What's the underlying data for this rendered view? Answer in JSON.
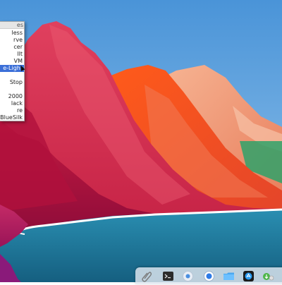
{
  "menu": {
    "header": "es",
    "items": [
      {
        "label": "less",
        "selected": false
      },
      {
        "label": "rve",
        "selected": false
      },
      {
        "label": "cer",
        "selected": false
      },
      {
        "label": "llt",
        "selected": false
      },
      {
        "label": "VM",
        "selected": false
      },
      {
        "label": "e-Light",
        "selected": true
      },
      {
        "label": "",
        "selected": false
      },
      {
        "label": "Stop",
        "selected": false
      },
      {
        "label": "",
        "selected": false
      },
      {
        "label": "2000",
        "selected": false
      },
      {
        "label": "lack",
        "selected": false
      },
      {
        "label": "re",
        "selected": false
      },
      {
        "label": "BlueSilk",
        "selected": false
      }
    ]
  },
  "dock": {
    "items": [
      {
        "name": "paperclip-icon"
      },
      {
        "name": "terminal-icon"
      },
      {
        "name": "app-icon"
      },
      {
        "name": "browser-icon"
      },
      {
        "name": "folder-icon"
      },
      {
        "name": "app-store-icon"
      },
      {
        "name": "download-icon"
      }
    ]
  },
  "colors": {
    "sky_top": "#4a94d8",
    "sky_bottom": "#9ac7ec",
    "water": "#1e7a9e",
    "mountain_red": "#c8163e",
    "mountain_orange": "#f25a24",
    "mountain_peach": "#f3a080",
    "shore": "#ffffff",
    "menu_highlight": "#3b6fd8"
  }
}
